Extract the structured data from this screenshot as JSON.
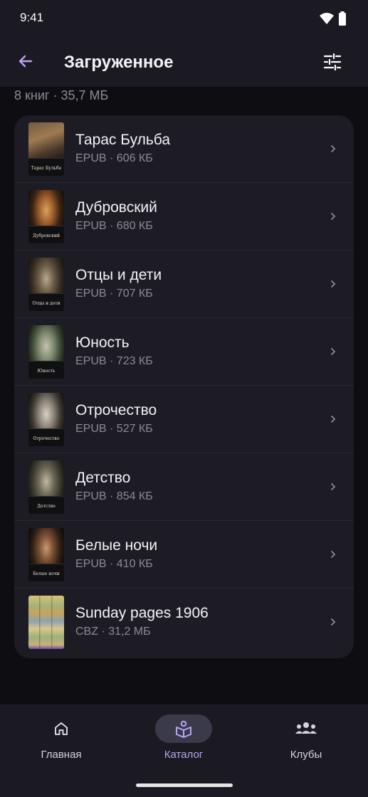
{
  "status_bar": {
    "time": "9:41",
    "icons": [
      "wifi-icon",
      "battery-icon"
    ]
  },
  "app_bar": {
    "title": "Загруженное",
    "back_icon": "arrow-left-icon",
    "filter_icon": "tune-sliders-icon"
  },
  "summary": "8 книг · 35,7 МБ",
  "books": [
    {
      "title": "Тарас Бульба",
      "meta": "EPUB · 606 КБ",
      "cover_label": "Тарас Бульба"
    },
    {
      "title": "Дубровский",
      "meta": "EPUB · 680 КБ",
      "cover_label": "Дубровский"
    },
    {
      "title": "Отцы и дети",
      "meta": "EPUB · 707 КБ",
      "cover_label": "Отцы и дети"
    },
    {
      "title": "Юность",
      "meta": "EPUB · 723 КБ",
      "cover_label": "Юность"
    },
    {
      "title": "Отрочество",
      "meta": "EPUB · 527 КБ",
      "cover_label": "Отрочество"
    },
    {
      "title": "Детство",
      "meta": "EPUB · 854 КБ",
      "cover_label": "Детство"
    },
    {
      "title": "Белые ночи",
      "meta": "EPUB · 410 КБ",
      "cover_label": "Белые ночи"
    },
    {
      "title": "Sunday pages 1906",
      "meta": "CBZ · 31,2 МБ",
      "cover_label": ""
    }
  ],
  "bottom_nav": {
    "items": [
      {
        "label": "Главная",
        "icon": "home-icon",
        "active": false
      },
      {
        "label": "Каталог",
        "icon": "book-reader-icon",
        "active": true
      },
      {
        "label": "Клубы",
        "icon": "group-icon",
        "active": false
      }
    ]
  },
  "colors": {
    "background": "#0e0e12",
    "bar": "#1b1a22",
    "card": "#1d1c24",
    "accent": "#b9a4f4",
    "active_pill": "#3b3a4b",
    "secondary_text": "#8d8a96"
  }
}
